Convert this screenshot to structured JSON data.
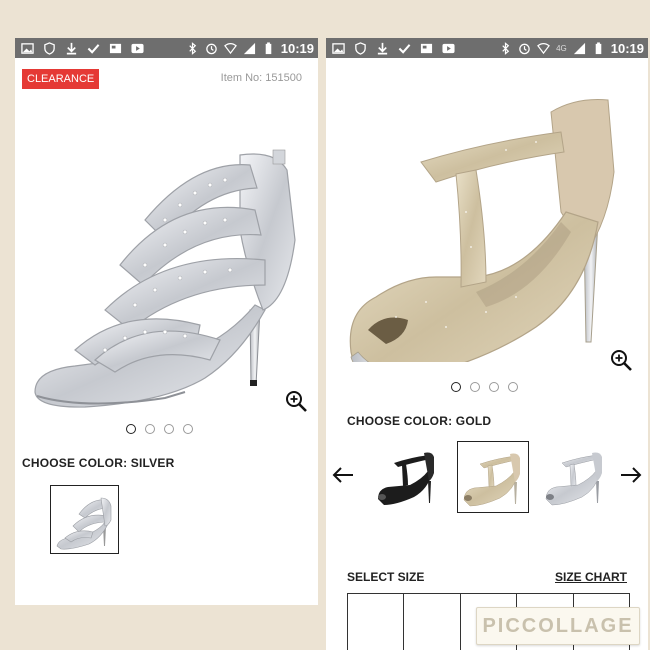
{
  "left_screen": {
    "status": {
      "time": "10:19"
    },
    "badge_label": "CLEARANCE",
    "item_number": "Item No: 151500",
    "choose_color_label": "CHOOSE COLOR: SILVER",
    "carousel": {
      "count": 4,
      "active_index": 0
    },
    "thumbnails": [
      {
        "color": "silver",
        "selected": true
      }
    ]
  },
  "right_screen": {
    "status": {
      "network": "4G",
      "time": "10:19"
    },
    "choose_color_label": "CHOOSE COLOR: GOLD",
    "carousel": {
      "count": 4,
      "active_index": 0
    },
    "thumbnails": [
      {
        "color": "black",
        "selected": false
      },
      {
        "color": "gold",
        "selected": true
      },
      {
        "color": "silver",
        "selected": false
      }
    ],
    "select_size_label": "SELECT SIZE",
    "size_chart_link": "SIZE CHART"
  },
  "watermark": {
    "text": "PICCOLLAGE"
  },
  "icons": {
    "status_left": [
      "image-icon",
      "shield-icon",
      "download-icon",
      "check-icon",
      "news-icon",
      "play-icon"
    ],
    "status_right": [
      "bluetooth-icon",
      "alarm-icon",
      "wifi-icon",
      "signal-icon",
      "battery-icon"
    ],
    "zoom": "zoom-in-icon",
    "prev": "arrow-left-icon",
    "next": "arrow-right-icon"
  },
  "colors": {
    "badge": "#e53935",
    "statusbar": "#6e6e6e",
    "collage_background": "#ece3d3",
    "silver": "#c9ccd2",
    "gold": "#cfc3a6",
    "black": "#1c1c1c"
  }
}
